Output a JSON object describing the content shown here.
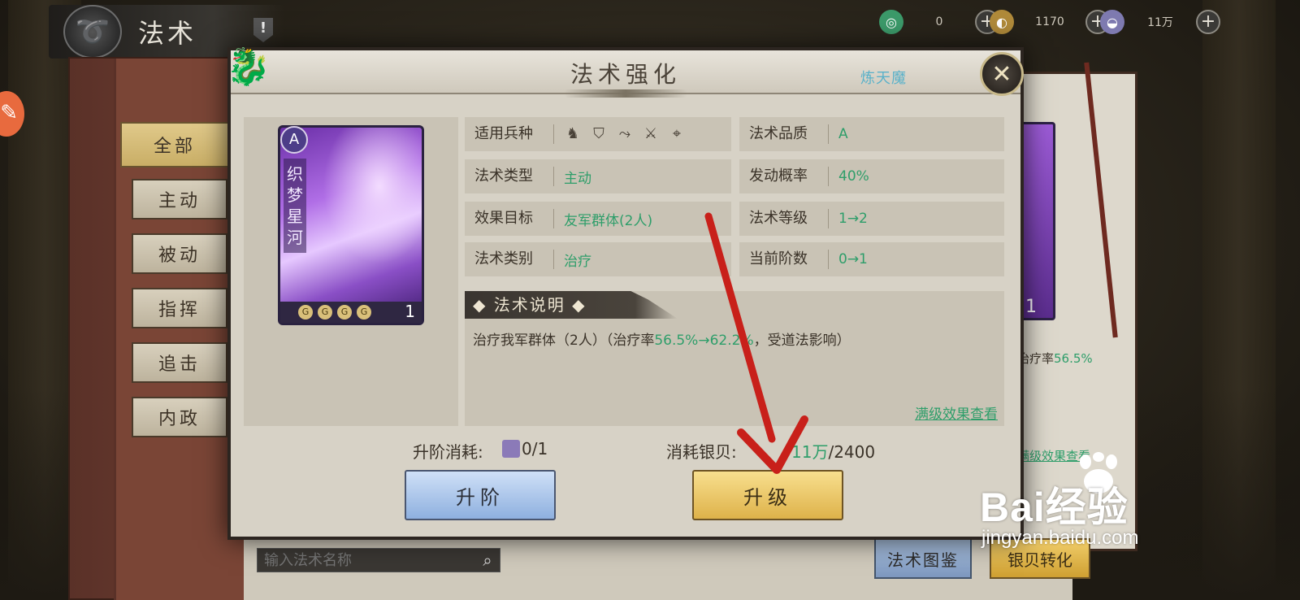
{
  "header": {
    "title": "法术",
    "back_icon": "back-dragon-icon",
    "alert_icon": "exclamation-icon"
  },
  "currencies": [
    {
      "icon": "jade-icon",
      "color": "#3c9a6a",
      "value": "0"
    },
    {
      "icon": "coin-icon",
      "color": "#b08a3a",
      "value": "1170"
    },
    {
      "icon": "silver-icon",
      "color": "#7e7ab0",
      "value": "11万"
    }
  ],
  "categories": {
    "all": "全部",
    "active": "主动",
    "passive": "被动",
    "command": "指挥",
    "pursuit": "追击",
    "domestic": "内政"
  },
  "modal": {
    "title": "法术强化",
    "hero_name": "炼天魔",
    "card": {
      "grade": "A",
      "name": "织梦星河",
      "level": "1",
      "stars": 4
    },
    "info": {
      "troop_label": "适用兵种",
      "troop_icons": [
        "cavalry-icon",
        "shield-icon",
        "bow-icon",
        "crossed-swords-icon",
        "target-icon"
      ],
      "type_label": "法术类型",
      "type_value": "主动",
      "target_label": "效果目标",
      "target_value": "友军群体(2人)",
      "category_label": "法术类别",
      "category_value": "治疗",
      "quality_label": "法术品质",
      "quality_value": "A",
      "chance_label": "发动概率",
      "chance_value": "40%",
      "level_label": "法术等级",
      "level_value": "1→2",
      "rank_label": "当前阶数",
      "rank_value": "0→1"
    },
    "description": {
      "heading": "法术说明",
      "text_before": "治疗我军群体（2人）（治疗率",
      "rate_from": "56.5%",
      "arrow": "→",
      "rate_to": "62.2%",
      "text_after": "，受道法影响）",
      "max_link": "满级效果查看"
    },
    "costs": {
      "advance_label": "升阶消耗:",
      "advance_value": "0/1",
      "silver_label": "消耗银贝:",
      "silver_have": "11万",
      "silver_need": "/2400"
    },
    "buttons": {
      "advance": "升阶",
      "upgrade": "升级"
    }
  },
  "background_page": {
    "heal_text": "治疗率",
    "heal_rate": "56.5%",
    "max_link": "满级效果查看",
    "card_level": "1"
  },
  "search": {
    "placeholder": "输入法术名称"
  },
  "bottom_buttons": {
    "codex": "法术图鉴",
    "convert": "银贝转化"
  },
  "watermark": {
    "brand": "Bai经验",
    "du": "du",
    "url": "jingyan.baidu.com"
  }
}
